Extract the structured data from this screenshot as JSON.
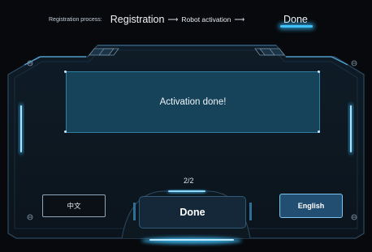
{
  "header": {
    "prefix": "Registration process:",
    "steps": [
      "Registration",
      "Robot activation",
      "Done"
    ],
    "arrow": "⟶"
  },
  "message": "Activation done!",
  "page_indicator": "2/2",
  "buttons": {
    "chinese": "中文",
    "done": "Done",
    "english": "English"
  },
  "colors": {
    "background": "#07090c",
    "accent": "#3fc3ff",
    "message_panel": "#17435a",
    "english_button": "#224e72"
  }
}
